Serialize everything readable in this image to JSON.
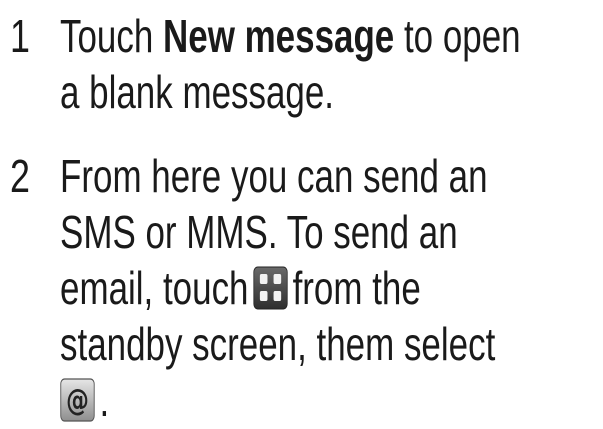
{
  "steps": [
    {
      "number": "1",
      "lines": [
        {
          "pre": "Touch ",
          "bold": "New message",
          "post": " to open"
        },
        {
          "text": "a blank message."
        }
      ]
    },
    {
      "number": "2",
      "lines": [
        {
          "text": "From here you can send an"
        },
        {
          "text": "SMS or MMS. To send an"
        },
        {
          "pre": "email, touch",
          "icon": "apps-grid-icon",
          "post": "from the"
        },
        {
          "text": "standby screen, them select"
        },
        {
          "icon": "at-sign-email-icon",
          "post": "."
        }
      ]
    }
  ]
}
